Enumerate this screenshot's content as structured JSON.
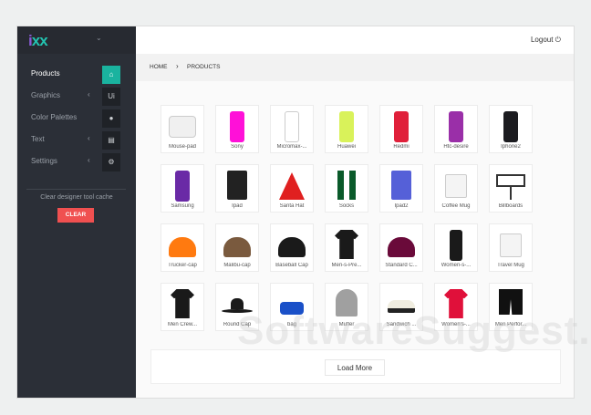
{
  "logo_text": "ixx",
  "sidebar": {
    "items": [
      {
        "label": "Products",
        "icon": "home-icon",
        "glyph": "⌂",
        "arrow": false,
        "active": true
      },
      {
        "label": "Graphics",
        "icon": "ui-icon",
        "glyph": "Ui",
        "arrow": true
      },
      {
        "label": "Color Palettes",
        "icon": "drop-icon",
        "glyph": "●",
        "arrow": false
      },
      {
        "label": "Text",
        "icon": "document-icon",
        "glyph": "▤",
        "arrow": true
      },
      {
        "label": "Settings",
        "icon": "gear-icon",
        "glyph": "⚙",
        "arrow": true
      }
    ],
    "cache_text": "Clear designer tool cache",
    "clear_label": "CLEAR"
  },
  "header": {
    "logout_label": "Logout",
    "logout_glyph": "⏻"
  },
  "breadcrumb": {
    "home": "HOME",
    "sep": "›",
    "current": "PRODUCTS"
  },
  "products": [
    {
      "name": "Mouse-pad",
      "shape": "pad-wide",
      "color": "#f0f0f0"
    },
    {
      "name": "Sony",
      "shape": "phone",
      "color": "#ff10d8"
    },
    {
      "name": "Micromax-...",
      "shape": "phone",
      "color": "#ffffff"
    },
    {
      "name": "Huawei",
      "shape": "phone",
      "color": "#d9f25a"
    },
    {
      "name": "Redmi",
      "shape": "phone",
      "color": "#e0203a"
    },
    {
      "name": "Htc-desire",
      "shape": "phone",
      "color": "#9a2fa8"
    },
    {
      "name": "Iphone2",
      "shape": "phone",
      "color": "#1c1c20"
    },
    {
      "name": "Samsung",
      "shape": "phone",
      "color": "#6a2aa6"
    },
    {
      "name": "Ipad",
      "shape": "tablet",
      "color": "#222"
    },
    {
      "name": "Santa Hat",
      "shape": "hat",
      "color": "#e02020"
    },
    {
      "name": "Socks",
      "shape": "socks",
      "color": "#0a5a2a"
    },
    {
      "name": "Ipad2",
      "shape": "tablet",
      "color": "#5560d8"
    },
    {
      "name": "Coffee Mug",
      "shape": "mug",
      "color": "#f4f4f4"
    },
    {
      "name": "Billboards",
      "shape": "board",
      "color": "#ffffff"
    },
    {
      "name": "Trucker-cap",
      "shape": "cap",
      "color": "#ff7a10"
    },
    {
      "name": "Malibu-cap",
      "shape": "cap",
      "color": "#7a5a3e"
    },
    {
      "name": "Baseball Cap",
      "shape": "cap",
      "color": "#1a1a1a"
    },
    {
      "name": "Men-s-Pre...",
      "shape": "shirt",
      "color": "#1a1a1a"
    },
    {
      "name": "Standard C...",
      "shape": "cap",
      "color": "#6a0a3a"
    },
    {
      "name": "Women-s-...",
      "shape": "pants",
      "color": "#1a1a1a"
    },
    {
      "name": "Travel Mug",
      "shape": "mug",
      "color": "#f4f4f4"
    },
    {
      "name": "Men Crew...",
      "shape": "shirt",
      "color": "#1a1a1a"
    },
    {
      "name": "Round Cap",
      "shape": "roundhat",
      "color": "#1a1a1a"
    },
    {
      "name": "bag",
      "shape": "bag",
      "color": "#1a50c8"
    },
    {
      "name": "Mufler",
      "shape": "beanie",
      "color": "#a0a0a0"
    },
    {
      "name": "Sandwich ...",
      "shape": "sailor",
      "color": "#f0ede0"
    },
    {
      "name": "Women's-...",
      "shape": "shirt",
      "color": "#e0103a"
    },
    {
      "name": "Men Perfor...",
      "shape": "shorts",
      "color": "#111"
    }
  ],
  "load_more_label": "Load More",
  "watermark": "SoftwareSuggest.com"
}
